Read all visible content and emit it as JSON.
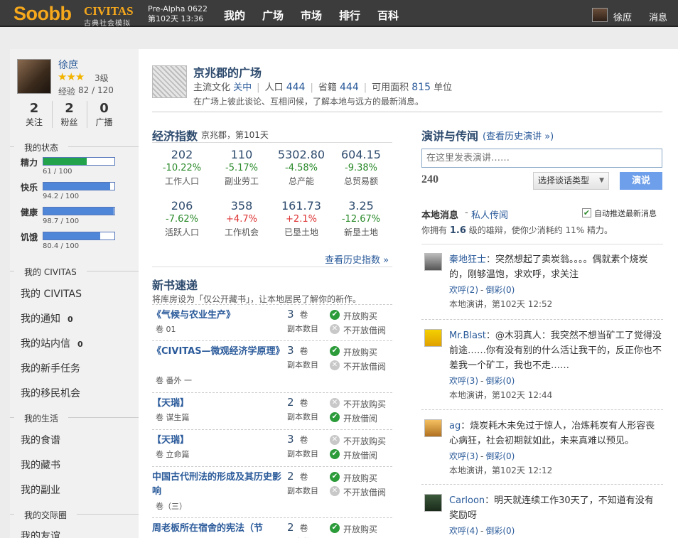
{
  "top": {
    "logo": "Soobb",
    "civitas": "CIVITAS",
    "civitas_sub": "古典社会模拟",
    "version": "Pre-Alpha 0622",
    "date": "第102天 13:36",
    "nav": [
      "我的",
      "广场",
      "市场",
      "排行",
      "百科"
    ],
    "user": "徐庶",
    "messages": "消息"
  },
  "profile": {
    "name": "徐庶",
    "level": "3级",
    "exp_label": "经验",
    "exp": "82 / 120",
    "stats": [
      {
        "num": "2",
        "label": "关注"
      },
      {
        "num": "2",
        "label": "粉丝"
      },
      {
        "num": "0",
        "label": "广播"
      }
    ]
  },
  "status": {
    "title": "我的状态",
    "items": [
      {
        "label": "精力",
        "value": "61 / 100",
        "level": 0.61,
        "color": "#22a24a"
      },
      {
        "label": "快乐",
        "value": "94.2 / 100",
        "level": 0.942,
        "color": "#4f86d8"
      },
      {
        "label": "健康",
        "value": "98.7 / 100",
        "level": 0.987,
        "color": "#4f86d8"
      },
      {
        "label": "饥饿",
        "value": "80.4 / 100",
        "level": 0.804,
        "color": "#4f86d8"
      }
    ]
  },
  "side": {
    "civ_title": "我的 CIVITAS",
    "civ_items": [
      {
        "label": "我的 CIVITAS",
        "count": ""
      },
      {
        "label": "我的通知",
        "count": "0"
      },
      {
        "label": "我的站内信",
        "count": "0"
      },
      {
        "label": "我的新手任务",
        "count": ""
      },
      {
        "label": "我的移民机会",
        "count": ""
      }
    ],
    "life_title": "我的生活",
    "life_items": [
      "我的食谱",
      "我的藏书",
      "我的副业"
    ],
    "social_title": "我的交际圈",
    "social_items": [
      "我的友谊"
    ]
  },
  "plaza": {
    "title": "京兆郡的广场",
    "culture_label": "主流文化",
    "culture": "关中",
    "pop_label": "人口",
    "pop": "444",
    "native_label": "省籍",
    "native": "444",
    "area_label": "可用面积",
    "area": "815",
    "area_unit": "单位",
    "desc": "在广场上彼此谈论、互相问候，了解本地与远方的最新消息。"
  },
  "econ": {
    "title": "经济指数",
    "sub": "京兆郡，第101天",
    "items": [
      {
        "value": "202",
        "change": "-10.22%",
        "label": "工作人口",
        "up": false
      },
      {
        "value": "110",
        "change": "-5.17%",
        "label": "副业劳工",
        "up": false
      },
      {
        "value": "5302.80",
        "change": "-4.58%",
        "label": "总产能",
        "up": false
      },
      {
        "value": "604.15",
        "change": "-9.38%",
        "label": "总贸易额",
        "up": false
      },
      {
        "value": "206",
        "change": "-7.62%",
        "label": "活跃人口",
        "up": false
      },
      {
        "value": "358",
        "change": "+4.7%",
        "label": "工作机会",
        "up": true
      },
      {
        "value": "161.73",
        "change": "+2.1%",
        "label": "已垦土地",
        "up": true
      },
      {
        "value": "3.25",
        "change": "-12.67%",
        "label": "新垦土地",
        "up": false
      }
    ],
    "history": "查看历史指数 »"
  },
  "books": {
    "title": "新书速递",
    "desc": "将库房设为「仅公开藏书」，让本地居民了解你的新作。",
    "copies_label": "副本数目",
    "unit": "卷",
    "rows": [
      {
        "title": "《气候与农业生产》",
        "sub": "卷 01",
        "copies": "3",
        "buy": "开放购买",
        "lend": "不开放借阅",
        "buy_ok": true,
        "lend_ok": false
      },
      {
        "title": "《CIVITAS—微观经济学原理》",
        "sub": "卷 番外 一",
        "copies": "3",
        "buy": "开放购买",
        "lend": "不开放借阅",
        "buy_ok": true,
        "lend_ok": false
      },
      {
        "title": "【天瑞】",
        "sub": "卷 谋生篇",
        "copies": "2",
        "buy": "不开放购买",
        "lend": "开放借阅",
        "buy_ok": false,
        "lend_ok": true
      },
      {
        "title": "【天瑞】",
        "sub": "卷 立命篇",
        "copies": "3",
        "buy": "不开放购买",
        "lend": "开放借阅",
        "buy_ok": false,
        "lend_ok": true
      },
      {
        "title": "中国古代刑法的形成及其历史影响",
        "sub": "卷（三）",
        "copies": "2",
        "buy": "开放购买",
        "lend": "不开放借阅",
        "buy_ok": true,
        "lend_ok": false
      },
      {
        "title": "周老板所在宿舍的宪法（节",
        "sub": "",
        "copies": "2",
        "buy": "开放购买",
        "lend": "",
        "buy_ok": true,
        "lend_ok": false
      }
    ]
  },
  "speech": {
    "title": "演讲与传闻",
    "history": "(查看历史演讲 »)",
    "placeholder": "在这里发表演讲……",
    "counter": "240",
    "type_select": "选择谈话类型",
    "submit": "演说",
    "local": "本地消息",
    "rumor": "私人传闻",
    "auto": "自动推送最新消息",
    "eloq_pre": "你拥有",
    "eloq_level": "1.6",
    "eloq_post": "级的雄辩，使你少消耗约",
    "eloq_pct": "11%",
    "eloq_end": "精力。",
    "messages": [
      {
        "user": "秦地狂士",
        "text": "：突然想起了卖炭翁。。。。偶就素个烧炭的，刚够温饱，求欢呼，求关注",
        "cheer": "欢呼(2)",
        "boo": "倒彩(0)",
        "meta": "本地演讲，第102天 12:52"
      },
      {
        "user": "Mr.Blast",
        "text": "：@木羽真人：我突然不想当矿工了觉得没前途……你有没有别的什么活让我干的，反正你也不差我一个矿工，我也不走……",
        "cheer": "欢呼(3)",
        "boo": "倒彩(0)",
        "meta": "本地演讲，第102天 12:44"
      },
      {
        "user": "ag",
        "text": "：烧炭耗木未免过于惊人，冶炼耗炭有人形容丧心病狂，社会初期就如此，未来真难以预见。",
        "cheer": "欢呼(3)",
        "boo": "倒彩(0)",
        "meta": "本地演讲，第102天 12:12"
      },
      {
        "user": "Carloon",
        "text": "：明天就连续工作30天了，不知道有没有奖励呀",
        "cheer": "欢呼(4)",
        "boo": "倒彩(0)",
        "meta": ""
      }
    ]
  }
}
